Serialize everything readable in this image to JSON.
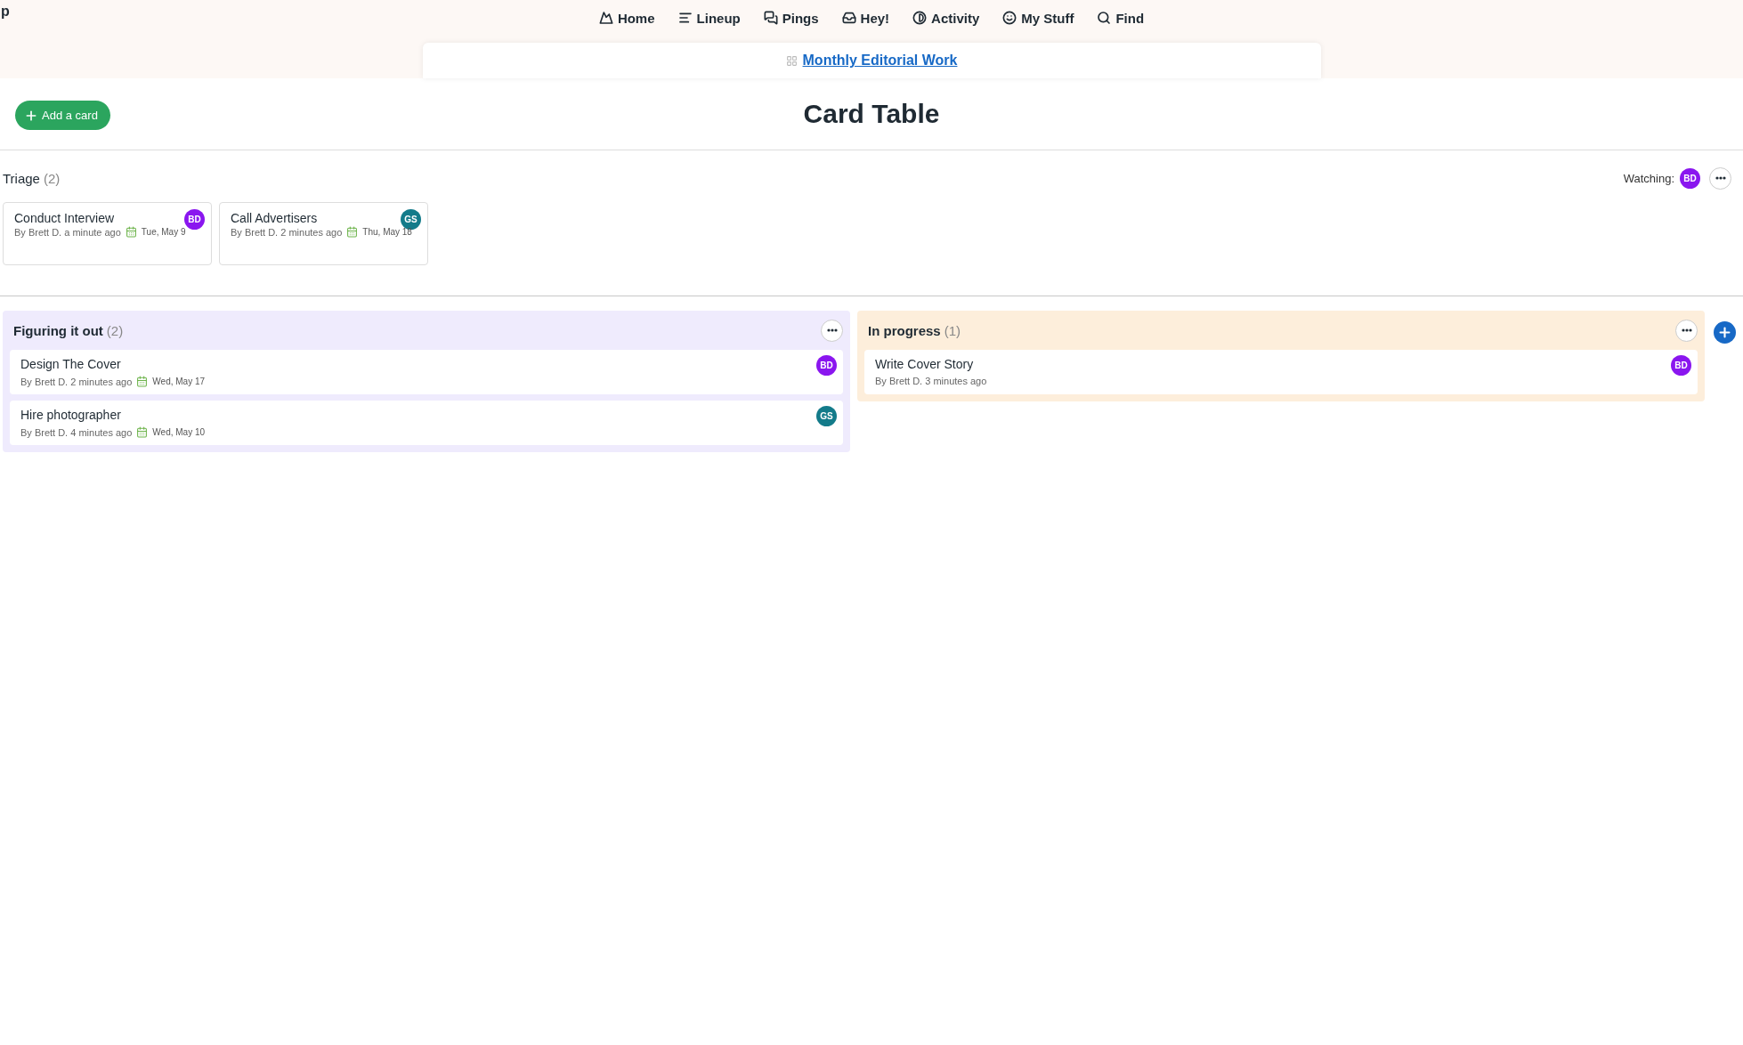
{
  "nav": {
    "cut_label": "p",
    "items": [
      {
        "label": "Home"
      },
      {
        "label": "Lineup"
      },
      {
        "label": "Pings"
      },
      {
        "label": "Hey!"
      },
      {
        "label": "Activity"
      },
      {
        "label": "My Stuff"
      },
      {
        "label": "Find"
      }
    ]
  },
  "breadcrumb": {
    "label": "Monthly Editorial Work"
  },
  "add_button": "Add a card",
  "title": "Card Table",
  "triage": {
    "name": "Triage",
    "count": "(2)",
    "watching_label": "Watching:",
    "watchers": [
      {
        "initials": "BD",
        "color": "#8a16ef"
      }
    ],
    "cards": [
      {
        "title": "Conduct Interview",
        "meta": "By Brett D. a minute ago",
        "due": "Tue, May 9",
        "assignee": {
          "initials": "BD",
          "color": "#8a16ef"
        }
      },
      {
        "title": "Call Advertisers",
        "meta": "By Brett D. 2 minutes ago",
        "due": "Thu, May 18",
        "assignee": {
          "initials": "GS",
          "color": "#137b8a"
        }
      }
    ]
  },
  "columns": [
    {
      "name": "Figuring it out",
      "count": "(2)",
      "color": "#efebfd",
      "cards": [
        {
          "title": "Design The Cover",
          "meta": "By Brett D. 2 minutes ago",
          "due": "Wed, May 17",
          "assignee": {
            "initials": "BD",
            "color": "#8a16ef"
          }
        },
        {
          "title": "Hire photographer",
          "meta": "By Brett D. 4 minutes ago",
          "due": "Wed, May 10",
          "assignee": {
            "initials": "GS",
            "color": "#137b8a"
          }
        }
      ]
    },
    {
      "name": "In progress",
      "count": "(1)",
      "color": "#fdeedb",
      "cards": [
        {
          "title": "Write Cover Story",
          "meta": "By Brett D. 3 minutes ago",
          "assignee": {
            "initials": "BD",
            "color": "#8a16ef"
          }
        }
      ]
    }
  ]
}
